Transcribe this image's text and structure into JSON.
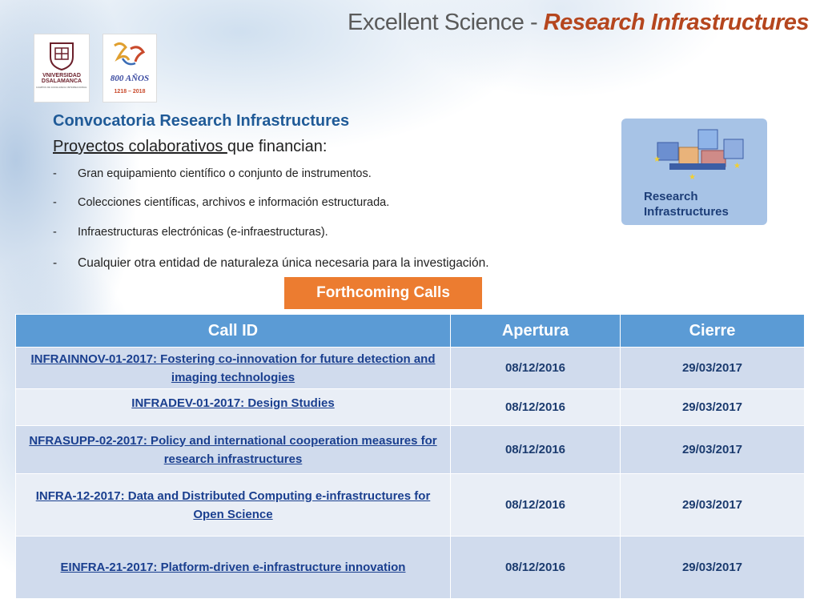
{
  "header": {
    "title_part1": "Excellent Science - ",
    "title_part2": "Research Infrastructures"
  },
  "logos": {
    "university_line1": "VNIVERSIDAD",
    "university_line2": "DSALAMANCA",
    "university_line3": "CAMPUS DE EXCELENCIA INTERNACIONAL",
    "anniversary_text": "800 AÑOS",
    "anniversary_years": "1218 - 2018"
  },
  "content": {
    "heading": "Convocatoria  Research Infrastructures",
    "subheading_underlined": "Proyectos colaborativos ",
    "subheading_rest": "que financian:",
    "bullets": [
      "Gran equipamiento científico o conjunto de instrumentos.",
      "Colecciones científicas, archivos e información estructurada.",
      "Infraestructuras electrónicas (e-infraestructuras).",
      "Cualquier otra entidad de naturaleza única necesaria para la investigación."
    ],
    "dash": "-"
  },
  "ri_image": {
    "line1": "Research",
    "line2": "Infrastructures"
  },
  "forthcoming_button": "Forthcoming Calls",
  "table": {
    "headers": [
      "Call ID",
      "Apertura",
      "Cierre"
    ],
    "rows": [
      {
        "call_id": "INFRAINNOV-01-2017: Fostering co-innovation for future detection and imaging technologies",
        "apertura": "08/12/2016",
        "cierre": "29/03/2017"
      },
      {
        "call_id": "INFRADEV-01-2017: Design Studies",
        "apertura": "08/12/2016",
        "cierre": "29/03/2017"
      },
      {
        "call_id": "NFRASUPP-02-2017: Policy and international cooperation measures for research infrastructures",
        "apertura": "08/12/2016",
        "cierre": "29/03/2017"
      },
      {
        "call_id": "INFRA-12-2017: Data and Distributed Computing e-infrastructures for Open Science",
        "apertura": "08/12/2016",
        "cierre": "29/03/2017"
      },
      {
        "call_id": "EINFRA-21-2017: Platform-driven e-infrastructure innovation",
        "apertura": "08/12/2016",
        "cierre": "29/03/2017"
      }
    ]
  },
  "colors": {
    "title_accent": "#b5461e",
    "heading": "#1f5a97",
    "button": "#ec7c30",
    "table_header": "#5b9bd5",
    "row_odd": "#d0dbed",
    "row_even": "#e9eef6",
    "link": "#1a3f8f"
  }
}
